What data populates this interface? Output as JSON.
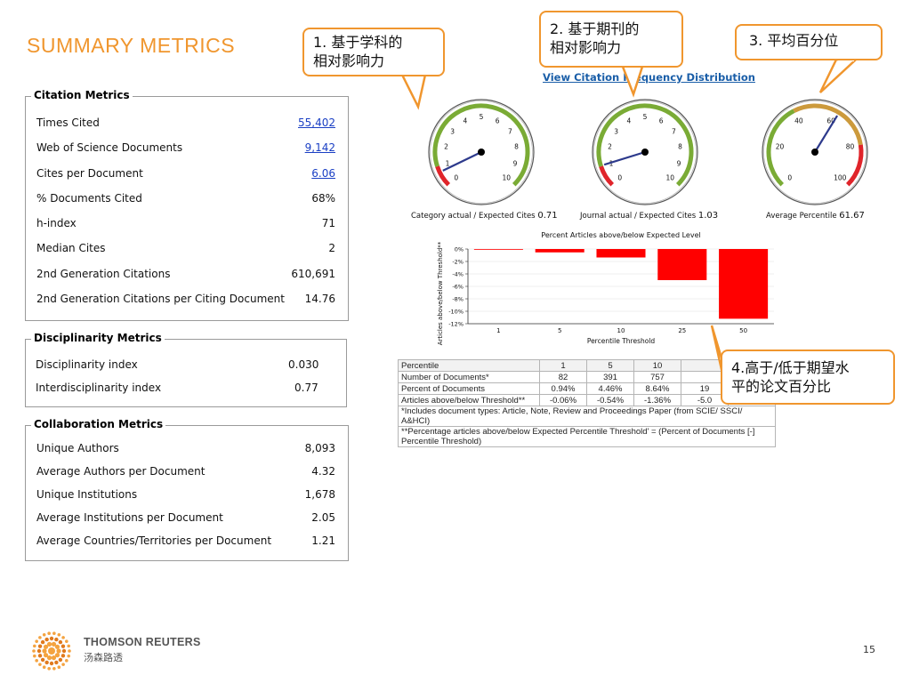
{
  "title": "SUMMARY METRICS",
  "citation_metrics": {
    "legend": "Citation Metrics",
    "rows": [
      {
        "label": "Times Cited",
        "value": "55,402"
      },
      {
        "label": "Web of Science Documents",
        "value": "9,142"
      },
      {
        "label": "Cites per Document",
        "value": "6.06"
      },
      {
        "label": "% Documents Cited",
        "value": "68%"
      },
      {
        "label": "h-index",
        "value": "71"
      },
      {
        "label": "Median Cites",
        "value": "2"
      },
      {
        "label": "2nd Generation Citations",
        "value": "610,691"
      },
      {
        "label": "2nd Generation Citations per Citing Document",
        "value": "14.76"
      }
    ]
  },
  "disciplinarity_metrics": {
    "legend": "Disciplinarity Metrics",
    "rows": [
      {
        "label": "Disciplinarity index",
        "value": "0.030"
      },
      {
        "label": "Interdisciplinarity index",
        "value": "0.77"
      }
    ]
  },
  "collaboration_metrics": {
    "legend": "Collaboration Metrics",
    "rows": [
      {
        "label": "Unique Authors",
        "value": "8,093"
      },
      {
        "label": "Average Authors per Document",
        "value": "4.32"
      },
      {
        "label": "Unique Institutions",
        "value": "1,678"
      },
      {
        "label": "Average Institutions per Document",
        "value": "2.05"
      },
      {
        "label": "Average Countries/Territories per Document",
        "value": "1.21"
      }
    ]
  },
  "callouts": {
    "c1_line1": "1. 基于学科的",
    "c1_line2": "相对影响力",
    "c2_line1": "2. 基于期刊的",
    "c2_line2": "相对影响力",
    "c3": "3. 平均百分位",
    "c4_line1": "4.高于/低于期望水",
    "c4_line2": "平的论文百分比"
  },
  "view_link": "View Citation Frequency Distribution",
  "gauges": [
    {
      "label": "Category actual / Expected Cites",
      "value": "0.71",
      "ticks": [
        "0",
        "1",
        "2",
        "3",
        "4",
        "5",
        "6",
        "7",
        "8",
        "9",
        "10"
      ],
      "needle": 0.71
    },
    {
      "label": "Journal actual / Expected Cites",
      "value": "1.03",
      "ticks": [
        "0",
        "1",
        "2",
        "3",
        "4",
        "5",
        "6",
        "7",
        "8",
        "9",
        "10"
      ],
      "needle": 1.03
    },
    {
      "label": "Average Percentile",
      "value": "61.67",
      "ticks": [
        "0",
        "20",
        "40",
        "60",
        "80",
        "100"
      ],
      "needle": 61.67
    }
  ],
  "chart_data": {
    "type": "bar",
    "title": "Percent Articles above/below Expected Level",
    "xlabel": "Percentile Threshold",
    "ylabel": "Articles above/below Threshold**",
    "categories": [
      "1",
      "5",
      "10",
      "25",
      "50"
    ],
    "values": [
      -0.06,
      -0.54,
      -1.36,
      -5.0,
      -11.2
    ],
    "yticks": [
      "0%",
      "-2%",
      "-4%",
      "-6%",
      "-8%",
      "-10%",
      "-12%"
    ],
    "ylim": [
      -12,
      0
    ],
    "color": "#ff0000",
    "grid": true
  },
  "table": {
    "rows": [
      [
        "Percentile",
        "1",
        "5",
        "10",
        "",
        ""
      ],
      [
        "Number of Documents*",
        "82",
        "391",
        "757",
        "",
        ""
      ],
      [
        "Percent of Documents",
        "0.94%",
        "4.46%",
        "8.64%",
        "19",
        ""
      ],
      [
        "Articles above/below Threshold**",
        "-0.06%",
        "-0.54%",
        "-1.36%",
        "-5.0",
        ""
      ]
    ],
    "note1": "*Includes document types: Article, Note, Review and Proceedings Paper (from SCIE/ SSCI/ A&HCI)",
    "note2a": "**Percentage articles  above/below Expected Percentile Threshold' = (Percent of Documents [-]",
    "note2b": "Percentile Threshold)"
  },
  "footer": {
    "brand": "THOMSON REUTERS",
    "brand_cn": "汤森路透",
    "page": "15"
  },
  "colors": {
    "accent": "#f0962e",
    "link": "#1a3fc4",
    "bar": "#ff0000",
    "gauge_green": "#7aab35",
    "gauge_red": "#e0242a",
    "needle": "#2d3a8c"
  }
}
